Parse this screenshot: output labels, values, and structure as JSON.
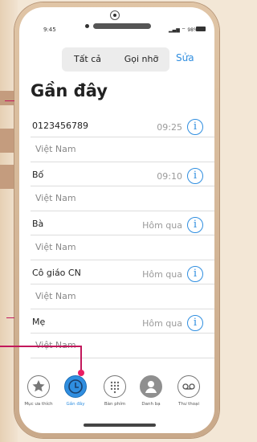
{
  "status": {
    "time": "9:45",
    "battery": "98%"
  },
  "segment": {
    "all": "Tất cả",
    "missed": "Gọi nhỡ"
  },
  "edit_label": "Sửa",
  "title": "Gần đây",
  "calls": [
    {
      "name": "0123456789",
      "sub": "Việt Nam",
      "when": "09:25"
    },
    {
      "name": "Bố",
      "sub": "Việt Nam",
      "when": "09:10"
    },
    {
      "name": "Bà",
      "sub": "Việt Nam",
      "when": "Hôm qua"
    },
    {
      "name": "Cô giáo CN",
      "sub": "Việt Nam",
      "when": "Hôm qua"
    },
    {
      "name": "Mẹ",
      "sub": "Việt Nam",
      "when": "Hôm qua"
    }
  ],
  "tabs": [
    {
      "label": "Mục ưa thích",
      "icon": "star-icon"
    },
    {
      "label": "Gần đây",
      "icon": "clock-icon"
    },
    {
      "label": "Bàn phím",
      "icon": "keypad-icon"
    },
    {
      "label": "Danh bạ",
      "icon": "contact-icon"
    },
    {
      "label": "Thư thoại",
      "icon": "voicemail-icon"
    }
  ],
  "colors": {
    "accent": "#2f8ee0",
    "annotation": "#e91e63"
  }
}
